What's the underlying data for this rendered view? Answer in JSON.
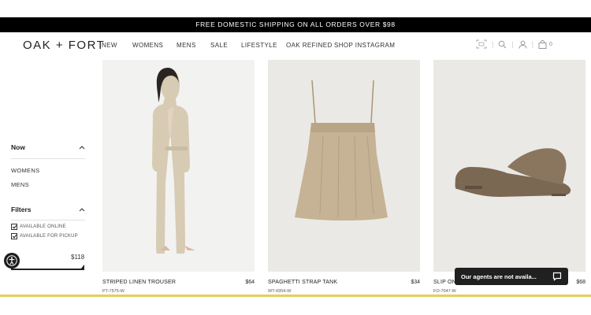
{
  "promo_banner": "FREE DOMESTIC SHIPPING ON ALL ORDERS OVER $98",
  "header": {
    "logo": "OAK + FORT",
    "nav": [
      "NEW",
      "WOMENS",
      "MENS",
      "SALE",
      "LIFESTYLE",
      "OAK REFINED",
      "SHOP INSTAGRAM"
    ],
    "icons": [
      "barcode-scan-icon",
      "search-icon",
      "user-icon",
      "shopping-bag-icon"
    ],
    "cart_count": "0"
  },
  "sidebar": {
    "new_section": {
      "title": "Now",
      "items": [
        "WOMENS",
        "MENS"
      ]
    },
    "filters_section": {
      "title": "Filters",
      "checkboxes": [
        {
          "label": "AVAILABLE ONLINE",
          "checked": true
        },
        {
          "label": "AVAILABLE FOR PICKUP",
          "checked": true
        }
      ],
      "price_max": "$118"
    }
  },
  "products": [
    {
      "name": "STRIPED LINEN TROUSER",
      "price": "$64",
      "sku": "PT-7575-W"
    },
    {
      "name": "SPAGHETTI STRAP TANK",
      "price": "$34",
      "sku": "WT-6954-W"
    },
    {
      "name": "SLIP ON",
      "price": "$68",
      "sku": "FO-7047-W"
    }
  ],
  "chat_widget": {
    "text": "Our agents are not availa..."
  },
  "colors": {
    "promo_bg": "#000000",
    "bottom_bar": "#e2cf5a",
    "product_bg": "#ebe9e5"
  }
}
